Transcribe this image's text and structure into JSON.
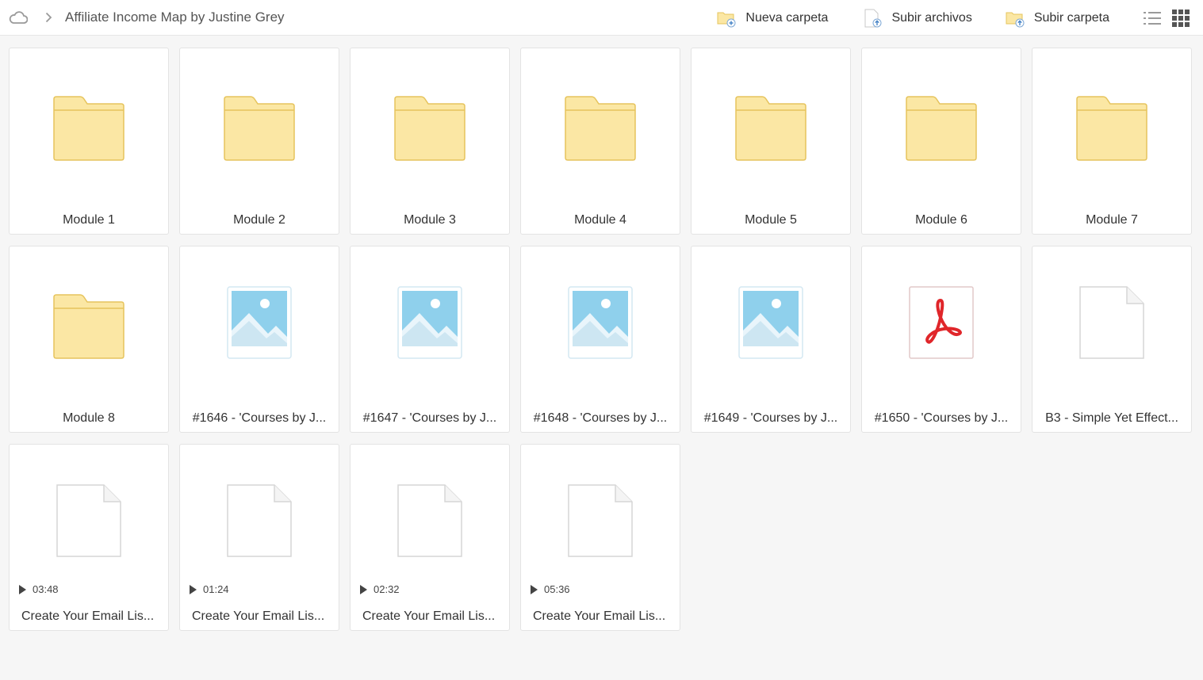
{
  "breadcrumb": {
    "title": "Affiliate Income Map by Justine Grey"
  },
  "toolbar": {
    "new_folder": "Nueva carpeta",
    "upload_files": "Subir archivos",
    "upload_folder": "Subir carpeta"
  },
  "colors": {
    "folder": "#fbe7a4",
    "folder_stroke": "#e6c45d",
    "image_sky": "#8fd0ec",
    "pdf_red": "#e0262a"
  },
  "items": [
    {
      "type": "folder",
      "name": "Module 1"
    },
    {
      "type": "folder",
      "name": "Module 2"
    },
    {
      "type": "folder",
      "name": "Module 3"
    },
    {
      "type": "folder",
      "name": "Module 4"
    },
    {
      "type": "folder",
      "name": "Module 5"
    },
    {
      "type": "folder",
      "name": "Module 6"
    },
    {
      "type": "folder",
      "name": "Module 7"
    },
    {
      "type": "folder",
      "name": "Module 8"
    },
    {
      "type": "image",
      "name": "#1646 - 'Courses by J..."
    },
    {
      "type": "image",
      "name": "#1647 - 'Courses by J..."
    },
    {
      "type": "image",
      "name": "#1648 - 'Courses by J..."
    },
    {
      "type": "image",
      "name": "#1649 - 'Courses by J..."
    },
    {
      "type": "pdf",
      "name": "#1650 - 'Courses by J..."
    },
    {
      "type": "file",
      "name": "B3 - Simple Yet Effect..."
    },
    {
      "type": "video",
      "name": "Create Your Email Lis...",
      "duration": "03:48"
    },
    {
      "type": "video",
      "name": "Create Your Email Lis...",
      "duration": "01:24"
    },
    {
      "type": "video",
      "name": "Create Your Email Lis...",
      "duration": "02:32"
    },
    {
      "type": "video",
      "name": "Create Your Email Lis...",
      "duration": "05:36"
    }
  ]
}
